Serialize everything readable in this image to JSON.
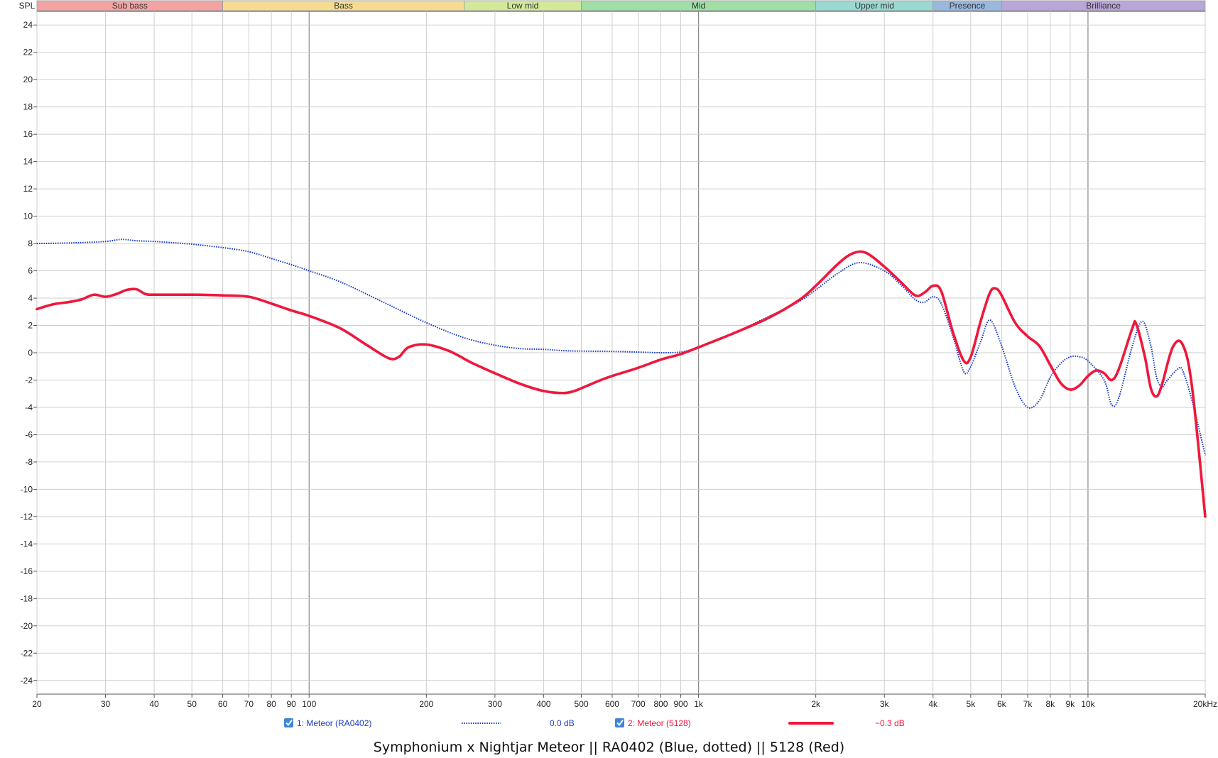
{
  "caption": "Symphonium x Nightjar Meteor || RA0402 (Blue, dotted) || 5128 (Red)",
  "chart_data": {
    "type": "line",
    "xscale": "log",
    "xlim": [
      20,
      20000
    ],
    "ylim": [
      -25,
      25
    ],
    "ylabel": "SPL",
    "grid": true,
    "x_ticks": [
      {
        "v": 20,
        "label": "20"
      },
      {
        "v": 30,
        "label": "30"
      },
      {
        "v": 40,
        "label": "40"
      },
      {
        "v": 50,
        "label": "50"
      },
      {
        "v": 60,
        "label": "60"
      },
      {
        "v": 70,
        "label": "70"
      },
      {
        "v": 80,
        "label": "80"
      },
      {
        "v": 90,
        "label": "90"
      },
      {
        "v": 100,
        "label": "100"
      },
      {
        "v": 200,
        "label": "200"
      },
      {
        "v": 300,
        "label": "300"
      },
      {
        "v": 400,
        "label": "400"
      },
      {
        "v": 500,
        "label": "500"
      },
      {
        "v": 600,
        "label": "600"
      },
      {
        "v": 700,
        "label": "700"
      },
      {
        "v": 800,
        "label": "800"
      },
      {
        "v": 900,
        "label": "900"
      },
      {
        "v": 1000,
        "label": "1k"
      },
      {
        "v": 2000,
        "label": "2k"
      },
      {
        "v": 3000,
        "label": "3k"
      },
      {
        "v": 4000,
        "label": "4k"
      },
      {
        "v": 5000,
        "label": "5k"
      },
      {
        "v": 6000,
        "label": "6k"
      },
      {
        "v": 7000,
        "label": "7k"
      },
      {
        "v": 8000,
        "label": "8k"
      },
      {
        "v": 9000,
        "label": "9k"
      },
      {
        "v": 10000,
        "label": "10k"
      },
      {
        "v": 20000,
        "label": "20kHz"
      }
    ],
    "y_ticks": [
      24,
      22,
      20,
      18,
      16,
      14,
      12,
      10,
      8,
      6,
      4,
      2,
      0,
      -2,
      -4,
      -6,
      -8,
      -10,
      -12,
      -14,
      -16,
      -18,
      -20,
      -22,
      -24
    ],
    "bands": [
      {
        "name": "Sub bass",
        "from": 20,
        "to": 60,
        "color": "#f4a3a3"
      },
      {
        "name": "Bass",
        "from": 60,
        "to": 250,
        "color": "#f6dc92"
      },
      {
        "name": "Low mid",
        "from": 250,
        "to": 500,
        "color": "#d4e89a"
      },
      {
        "name": "Mid",
        "from": 500,
        "to": 2000,
        "color": "#9fdfa6"
      },
      {
        "name": "Upper mid",
        "from": 2000,
        "to": 4000,
        "color": "#9ad9d1"
      },
      {
        "name": "Presence",
        "from": 4000,
        "to": 6000,
        "color": "#98b8e0"
      },
      {
        "name": "Brilliance",
        "from": 6000,
        "to": 20000,
        "color": "#b8a6d6"
      }
    ],
    "series": [
      {
        "name": "1: Meteor (RA0402)",
        "offset_label": "0.0 dB",
        "color": "#1a3fc8",
        "style": "dotted",
        "checked": true,
        "points": [
          [
            20,
            8.0
          ],
          [
            25,
            8.05
          ],
          [
            30,
            8.15
          ],
          [
            33,
            8.3
          ],
          [
            36,
            8.2
          ],
          [
            40,
            8.15
          ],
          [
            45,
            8.05
          ],
          [
            50,
            7.95
          ],
          [
            60,
            7.7
          ],
          [
            70,
            7.4
          ],
          [
            80,
            6.9
          ],
          [
            90,
            6.45
          ],
          [
            100,
            6.0
          ],
          [
            120,
            5.2
          ],
          [
            150,
            3.9
          ],
          [
            200,
            2.2
          ],
          [
            250,
            1.1
          ],
          [
            300,
            0.55
          ],
          [
            350,
            0.3
          ],
          [
            400,
            0.25
          ],
          [
            450,
            0.15
          ],
          [
            500,
            0.12
          ],
          [
            600,
            0.1
          ],
          [
            700,
            0.05
          ],
          [
            800,
            0.0
          ],
          [
            900,
            0.05
          ],
          [
            1000,
            0.4
          ],
          [
            1200,
            1.3
          ],
          [
            1500,
            2.6
          ],
          [
            1800,
            3.7
          ],
          [
            2000,
            4.6
          ],
          [
            2300,
            5.9
          ],
          [
            2600,
            6.6
          ],
          [
            3000,
            6.0
          ],
          [
            3300,
            5.0
          ],
          [
            3600,
            3.9
          ],
          [
            3800,
            3.7
          ],
          [
            4000,
            4.1
          ],
          [
            4200,
            3.6
          ],
          [
            4500,
            1.2
          ],
          [
            4800,
            -1.4
          ],
          [
            5000,
            -1.0
          ],
          [
            5300,
            0.8
          ],
          [
            5600,
            2.4
          ],
          [
            6000,
            0.5
          ],
          [
            6500,
            -2.5
          ],
          [
            7000,
            -4.0
          ],
          [
            7500,
            -3.5
          ],
          [
            8000,
            -1.8
          ],
          [
            8500,
            -0.8
          ],
          [
            9000,
            -0.3
          ],
          [
            9500,
            -0.3
          ],
          [
            10000,
            -0.6
          ],
          [
            11000,
            -2.0
          ],
          [
            11500,
            -3.8
          ],
          [
            12000,
            -3.3
          ],
          [
            13000,
            0.5
          ],
          [
            13800,
            2.3
          ],
          [
            14500,
            0.5
          ],
          [
            15000,
            -1.8
          ],
          [
            15500,
            -2.5
          ],
          [
            16000,
            -2.0
          ],
          [
            17000,
            -1.2
          ],
          [
            17500,
            -1.3
          ],
          [
            18500,
            -3.5
          ],
          [
            20000,
            -7.5
          ]
        ]
      },
      {
        "name": "2: Meteor (5128)",
        "offset_label": "−0.3 dB",
        "color": "#f0173c",
        "style": "solid",
        "checked": true,
        "points": [
          [
            20,
            3.2
          ],
          [
            22,
            3.55
          ],
          [
            24,
            3.7
          ],
          [
            26,
            3.9
          ],
          [
            28,
            4.25
          ],
          [
            30,
            4.1
          ],
          [
            32,
            4.3
          ],
          [
            34,
            4.6
          ],
          [
            36,
            4.65
          ],
          [
            38,
            4.3
          ],
          [
            40,
            4.25
          ],
          [
            50,
            4.25
          ],
          [
            60,
            4.2
          ],
          [
            70,
            4.1
          ],
          [
            80,
            3.6
          ],
          [
            90,
            3.1
          ],
          [
            100,
            2.7
          ],
          [
            120,
            1.8
          ],
          [
            140,
            0.6
          ],
          [
            160,
            -0.4
          ],
          [
            170,
            -0.3
          ],
          [
            180,
            0.4
          ],
          [
            200,
            0.6
          ],
          [
            230,
            0.1
          ],
          [
            260,
            -0.7
          ],
          [
            300,
            -1.5
          ],
          [
            350,
            -2.3
          ],
          [
            400,
            -2.8
          ],
          [
            450,
            -2.95
          ],
          [
            480,
            -2.8
          ],
          [
            500,
            -2.6
          ],
          [
            550,
            -2.1
          ],
          [
            600,
            -1.7
          ],
          [
            700,
            -1.1
          ],
          [
            800,
            -0.5
          ],
          [
            900,
            -0.1
          ],
          [
            1000,
            0.4
          ],
          [
            1200,
            1.3
          ],
          [
            1500,
            2.5
          ],
          [
            1800,
            3.8
          ],
          [
            2000,
            4.9
          ],
          [
            2300,
            6.6
          ],
          [
            2500,
            7.3
          ],
          [
            2700,
            7.3
          ],
          [
            3000,
            6.3
          ],
          [
            3300,
            5.2
          ],
          [
            3600,
            4.2
          ],
          [
            3800,
            4.4
          ],
          [
            4000,
            4.9
          ],
          [
            4200,
            4.5
          ],
          [
            4500,
            1.5
          ],
          [
            4800,
            -0.6
          ],
          [
            5000,
            -0.3
          ],
          [
            5300,
            2.3
          ],
          [
            5600,
            4.4
          ],
          [
            5800,
            4.7
          ],
          [
            6000,
            4.2
          ],
          [
            6500,
            2.2
          ],
          [
            7000,
            1.2
          ],
          [
            7500,
            0.5
          ],
          [
            8000,
            -0.9
          ],
          [
            8500,
            -2.2
          ],
          [
            9000,
            -2.7
          ],
          [
            9500,
            -2.4
          ],
          [
            10000,
            -1.7
          ],
          [
            10500,
            -1.3
          ],
          [
            11000,
            -1.5
          ],
          [
            11500,
            -2.0
          ],
          [
            12000,
            -1.2
          ],
          [
            13000,
            1.8
          ],
          [
            13300,
            2.1
          ],
          [
            14000,
            -0.3
          ],
          [
            14500,
            -2.6
          ],
          [
            15000,
            -3.2
          ],
          [
            15500,
            -2.3
          ],
          [
            16500,
            0.4
          ],
          [
            17500,
            0.6
          ],
          [
            18500,
            -2.5
          ],
          [
            20000,
            -12.0
          ]
        ]
      }
    ]
  }
}
